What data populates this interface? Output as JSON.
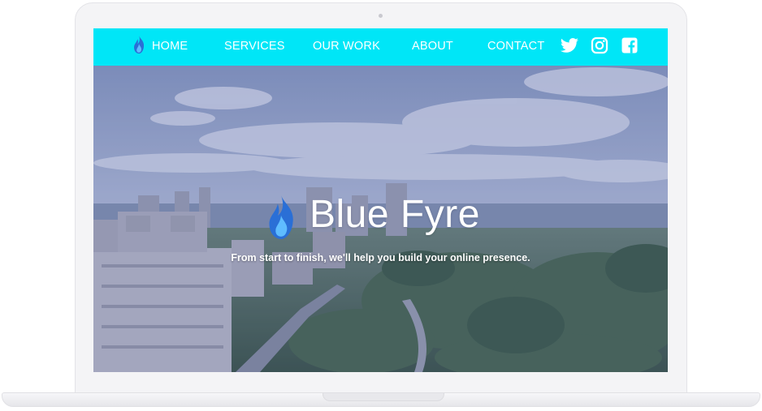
{
  "nav": {
    "items": [
      {
        "label": "HOME"
      },
      {
        "label": "SERVICES"
      },
      {
        "label": "OUR WORK"
      },
      {
        "label": "ABOUT"
      },
      {
        "label": "CONTACT"
      }
    ],
    "social": [
      "twitter-icon",
      "instagram-icon",
      "facebook-icon"
    ],
    "background": "#00e6f7"
  },
  "hero": {
    "brand_name": "Blue Fyre",
    "tagline": "From start to finish, we'll help you build your online presence.",
    "overlay_color": "#383a8c",
    "logo_colors": [
      "#2f7fe0",
      "#5ab8ff"
    ]
  }
}
